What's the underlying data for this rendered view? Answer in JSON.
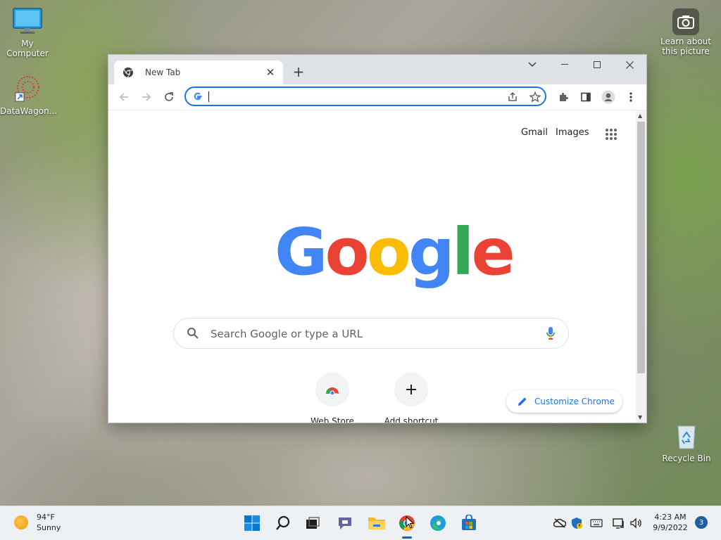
{
  "desktop": {
    "icons": [
      {
        "label": "My Computer",
        "icon": "monitor-icon"
      },
      {
        "label": "DataWagon...",
        "icon": "shortcut-app-icon"
      },
      {
        "label": "Learn about this picture",
        "icon": "camera-icon"
      },
      {
        "label": "Recycle Bin",
        "icon": "recycle-bin-icon"
      }
    ]
  },
  "browser": {
    "tab": {
      "title": "New Tab"
    },
    "omnibox": {
      "value": ""
    },
    "ntp": {
      "links": {
        "gmail": "Gmail",
        "images": "Images"
      },
      "search_placeholder": "Search Google or type a URL",
      "shortcuts": [
        {
          "label": "Web Store"
        },
        {
          "label": "Add shortcut"
        }
      ],
      "customize_label": "Customize Chrome"
    }
  },
  "taskbar": {
    "weather": {
      "temp": "94°F",
      "condition": "Sunny"
    },
    "clock": {
      "time": "4:23 AM",
      "date": "9/9/2022"
    },
    "notification_count": "3"
  },
  "colors": {
    "google_blue": "#4285F4",
    "google_red": "#EA4335",
    "google_yellow": "#FBBC05",
    "google_green": "#34A853",
    "accent": "#1a73e8"
  }
}
